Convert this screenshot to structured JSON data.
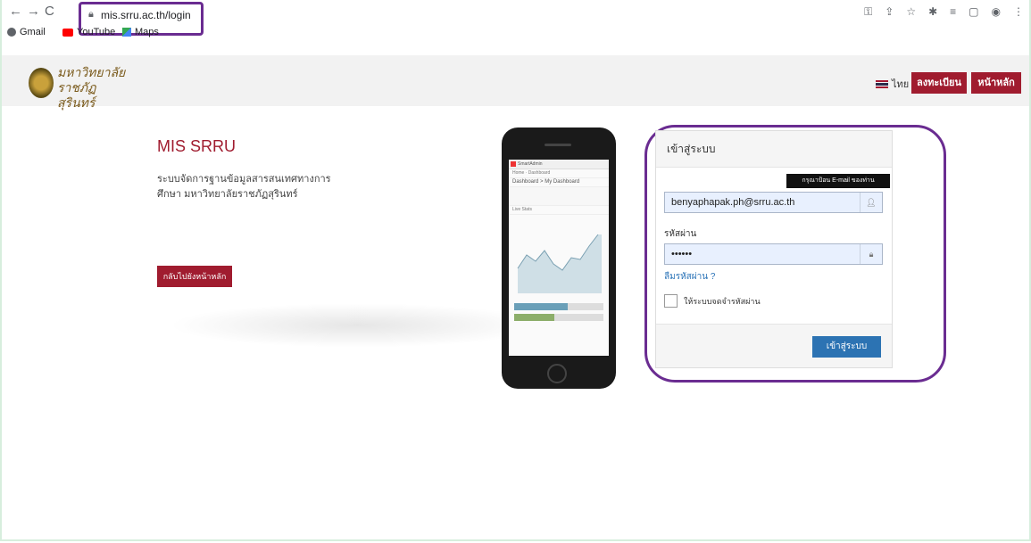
{
  "browser": {
    "url": "mis.srru.ac.th/login",
    "bookmarks": [
      {
        "label": "Gmail",
        "icon": "globe-icon"
      },
      {
        "label": "YouTube",
        "icon": "youtube-icon"
      },
      {
        "label": "Maps",
        "icon": "maps-icon"
      }
    ]
  },
  "header": {
    "logo_text_line1": "มหาวิทยาลัย",
    "logo_text_line2": "ราชภัฏสุรินทร์",
    "language": "ไทย",
    "register_label": "ลงทะเบียน",
    "home_label": "หน้าหลัก"
  },
  "main": {
    "title": "MIS SRRU",
    "description": "ระบบจัดการฐานข้อมูลสารสนเทศทางการศึกษา มหาวิทยาลัยราชภัฏสุรินทร์",
    "back_label": "กลับไปยังหน้าหลัก"
  },
  "phone": {
    "app_name": "SmartAdmin",
    "breadcrumb": "Home · Dashboard",
    "dashboard_title": "Dashboard > My Dashboard",
    "chart_label": "Live Stats"
  },
  "login": {
    "heading": "เข้าสู่ระบบ",
    "tooltip": "กรุณาป้อน E-mail ของท่าน",
    "email_value": "benyaphapak.ph@srru.ac.th",
    "password_label": "รหัสผ่าน",
    "password_value": "••••••",
    "forgot_label": "ลืมรหัสผ่าน ?",
    "remember_label": "ให้ระบบจดจำรหัสผ่าน",
    "submit_label": "เข้าสู่ระบบ"
  }
}
